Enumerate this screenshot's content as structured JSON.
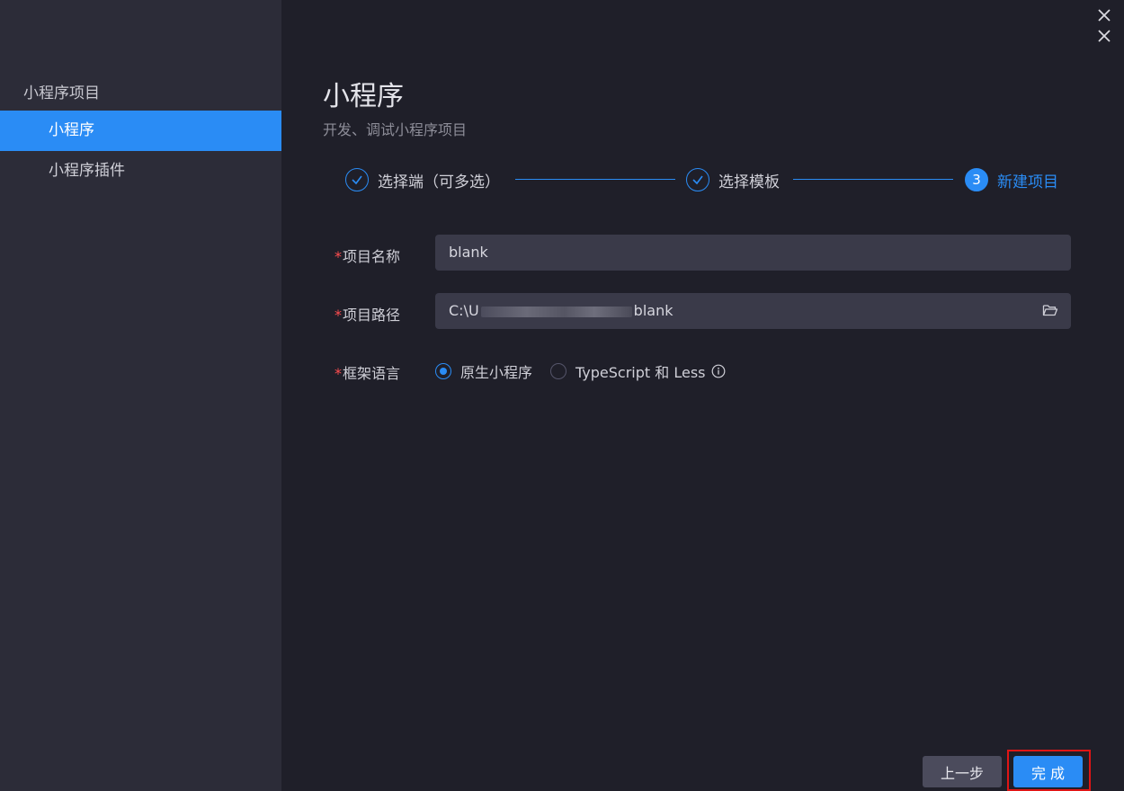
{
  "sidebar": {
    "group_label": "小程序项目",
    "items": [
      {
        "label": "小程序"
      },
      {
        "label": "小程序插件"
      }
    ]
  },
  "window": {
    "close_glyph": "X"
  },
  "header": {
    "title": "小程序",
    "subtitle": "开发、调试小程序项目"
  },
  "steps": [
    {
      "label": "选择端（可多选）",
      "status": "done"
    },
    {
      "label": "选择模板",
      "status": "done"
    },
    {
      "label": "新建项目",
      "status": "active",
      "number": "3"
    }
  ],
  "form": {
    "required_mark": "*",
    "name": {
      "label": "项目名称",
      "value": "blank"
    },
    "path": {
      "label": "项目路径",
      "value_prefix": "C:\\U",
      "value_suffix": "blank"
    },
    "language": {
      "label": "框架语言",
      "options": [
        {
          "label": "原生小程序",
          "checked": true
        },
        {
          "label": "TypeScript 和 Less",
          "checked": false
        }
      ]
    }
  },
  "footer": {
    "prev_label": "上一步",
    "done_label": "完 成"
  },
  "colors": {
    "accent": "#2a8cf5",
    "required": "#ff4d4f",
    "highlight": "#e01515"
  }
}
